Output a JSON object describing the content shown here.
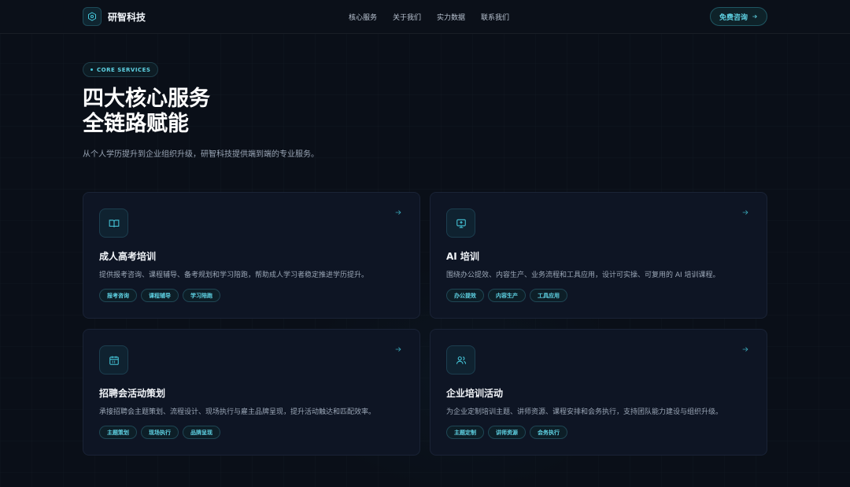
{
  "brand": {
    "name": "研智科技",
    "icon": "hexagon-icon",
    "accent": "#46c7da"
  },
  "nav": {
    "links": [
      "核心服务",
      "关于我们",
      "实力数据",
      "联系我们"
    ],
    "cta_label": "免费咨询"
  },
  "hero": {
    "badge": "CORE SERVICES",
    "title_line1": "四大核心服务",
    "title_line2": "全链路赋能",
    "subtitle": "从个人学历提升到企业组织升级，研智科技提供端到端的专业服务。"
  },
  "cards": [
    {
      "icon": "book-open-icon",
      "title": "成人高考培训",
      "desc": "提供报考咨询、课程辅导、备考规划和学习陪跑，帮助成人学习者稳定推进学历提升。",
      "tags": [
        "报考咨询",
        "课程辅导",
        "学习陪跑"
      ]
    },
    {
      "icon": "monitor-upload-icon",
      "title": "AI 培训",
      "desc": "围绕办公提效、内容生产、业务流程和工具应用，设计可实操、可复用的 AI 培训课程。",
      "tags": [
        "办公提效",
        "内容生产",
        "工具应用"
      ]
    },
    {
      "icon": "calendar-icon",
      "title": "招聘会活动策划",
      "desc": "承接招聘会主题策划、流程设计、现场执行与雇主品牌呈现，提升活动触达和匹配效率。",
      "tags": [
        "主题策划",
        "现场执行",
        "品牌呈现"
      ]
    },
    {
      "icon": "users-icon",
      "title": "企业培训活动",
      "desc": "为企业定制培训主题、讲师资源、课程安排和会务执行，支持团队能力建设与组织升级。",
      "tags": [
        "主题定制",
        "讲师资源",
        "会务执行"
      ]
    }
  ]
}
